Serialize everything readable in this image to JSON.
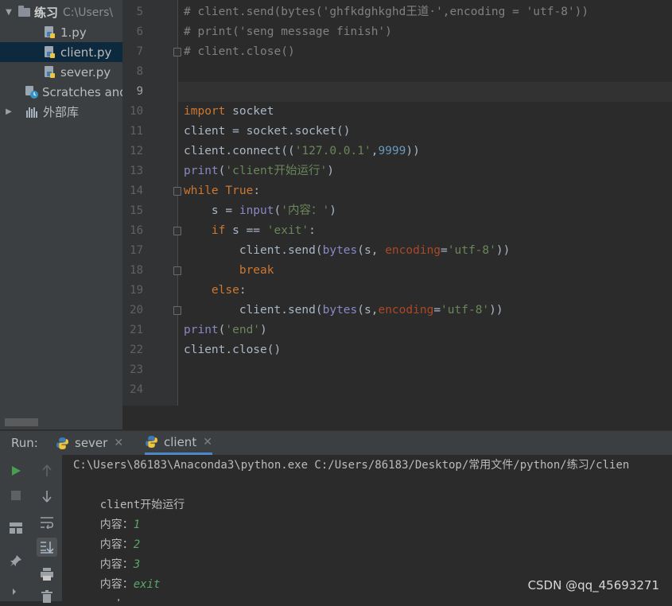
{
  "project_tree": {
    "root": {
      "name": "练习",
      "path_hint": "C:\\Users\\"
    },
    "files": [
      {
        "label": "1.py"
      },
      {
        "label": "client.py"
      },
      {
        "label": "sever.py"
      }
    ],
    "scratches": "Scratches and",
    "external_libs": "外部库"
  },
  "editor": {
    "current_line": "9",
    "lines": [
      {
        "num": "5",
        "text": "# client.send(bytes('ghfkdghkghd王道·',encoding = 'utf-8'))"
      },
      {
        "num": "6",
        "text": "# print('seng message finish')"
      },
      {
        "num": "7",
        "text": "# client.close()"
      },
      {
        "num": "8",
        "text": ""
      },
      {
        "num": "9",
        "text": ""
      },
      {
        "num": "10",
        "text": "import socket"
      },
      {
        "num": "11",
        "text": "client = socket.socket()"
      },
      {
        "num": "12",
        "text": "client.connect(('127.0.0.1',9999))"
      },
      {
        "num": "13",
        "text": "print('client开始运行')"
      },
      {
        "num": "14",
        "text": "while True:"
      },
      {
        "num": "15",
        "text": "    s = input('内容：')"
      },
      {
        "num": "16",
        "text": "    if s == 'exit':"
      },
      {
        "num": "17",
        "text": "        client.send(bytes(s, encoding='utf-8'))"
      },
      {
        "num": "18",
        "text": "        break"
      },
      {
        "num": "19",
        "text": "    else:"
      },
      {
        "num": "20",
        "text": "        client.send(bytes(s,encoding='utf-8'))"
      },
      {
        "num": "21",
        "text": "print('end')"
      },
      {
        "num": "22",
        "text": "client.close()"
      },
      {
        "num": "23",
        "text": ""
      },
      {
        "num": "24",
        "text": ""
      }
    ]
  },
  "run_panel": {
    "label": "Run:",
    "tabs": [
      {
        "label": "sever",
        "active": false
      },
      {
        "label": "client",
        "active": true
      }
    ],
    "console": {
      "command": "C:\\Users\\86183\\Anaconda3\\python.exe C:/Users/86183/Desktop/常用文件/python/练习/clien",
      "lines": [
        {
          "prompt": "client开始运行",
          "input": ""
        },
        {
          "prompt": "内容：",
          "input": "1"
        },
        {
          "prompt": "内容：",
          "input": "2"
        },
        {
          "prompt": "内容：",
          "input": "3"
        },
        {
          "prompt": "内容：",
          "input": "exit"
        },
        {
          "prompt": "end",
          "input": ""
        }
      ]
    },
    "toolbar_icons": [
      "run-icon",
      "stop-icon",
      "layout-icon",
      "pin-icon",
      "up-arrow-icon",
      "down-arrow-icon",
      "soft-wrap-icon",
      "scroll-to-end-icon",
      "print-icon",
      "trash-icon"
    ]
  },
  "watermark": "CSDN @qq_45693271",
  "colors": {
    "keyword": "#cc7832",
    "string": "#6a8759",
    "number": "#6897bb",
    "builtin": "#8888c6",
    "comment": "#808080",
    "param": "#aa4926",
    "console_input": "#59a869"
  }
}
